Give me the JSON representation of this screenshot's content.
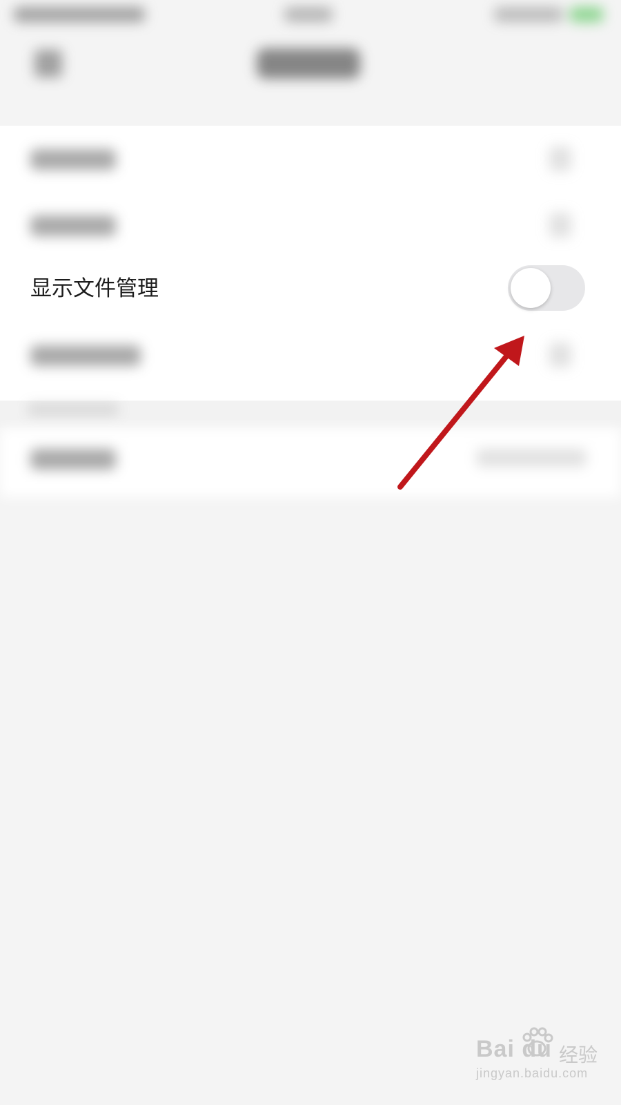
{
  "settings": {
    "focused_row": {
      "label": "显示文件管理",
      "toggle_on": false
    }
  },
  "colors": {
    "annotation_arrow": "#c0171b",
    "toggle_track_off": "#e7e7e9",
    "toggle_knob": "#ffffff"
  },
  "watermark": {
    "logo_text": "Bai du",
    "jingyan_text": "经验",
    "url": "jingyan.baidu.com"
  }
}
